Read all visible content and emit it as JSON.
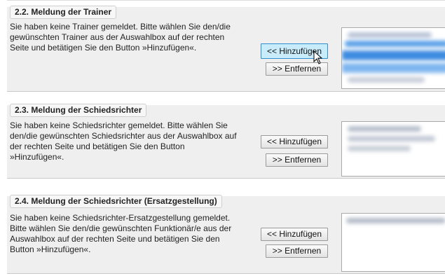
{
  "sections": [
    {
      "title": "2.2. Meldung der Trainer",
      "lines": [
        "Sie haben keine Trainer gemeldet. Bitte wählen Sie den/die",
        "gewünschten Trainer aus der Auswahlbox auf der rechten",
        "Seite und betätigen Sie den Button »Hinzufügen«."
      ],
      "add_label": "<< Hinzufügen",
      "remove_label": ">> Entfernen"
    },
    {
      "title": "2.3. Meldung der Schiedsrichter",
      "lines": [
        "Sie haben keine Schiedsrichter gemeldet. Bitte wählen Sie",
        "den/die gewünschten Schiedsrichter aus der Auswahlbox auf",
        "der rechten Seite und betätigen Sie den Button",
        "»Hinzufügen«."
      ],
      "add_label": "<< Hinzufügen",
      "remove_label": ">> Entfernen"
    },
    {
      "title": "2.4. Meldung der Schiedsrichter (Ersatzgestellung)",
      "lines": [
        "Sie haben keine Schiedsrichter-Ersatzgestellung gemeldet.",
        "Bitte wählen Sie den/die gewünschten Funktionär/e aus der",
        "Auswahlbox auf der rechten Seite und betätigen Sie den",
        "Button »Hinzufügen«."
      ],
      "add_label": "<< Hinzufügen",
      "remove_label": ">> Entfernen"
    }
  ],
  "colors": {
    "section_bg": "#efefef",
    "hover_button": "#c9ecfb",
    "selected_item": "#3d8be0"
  }
}
